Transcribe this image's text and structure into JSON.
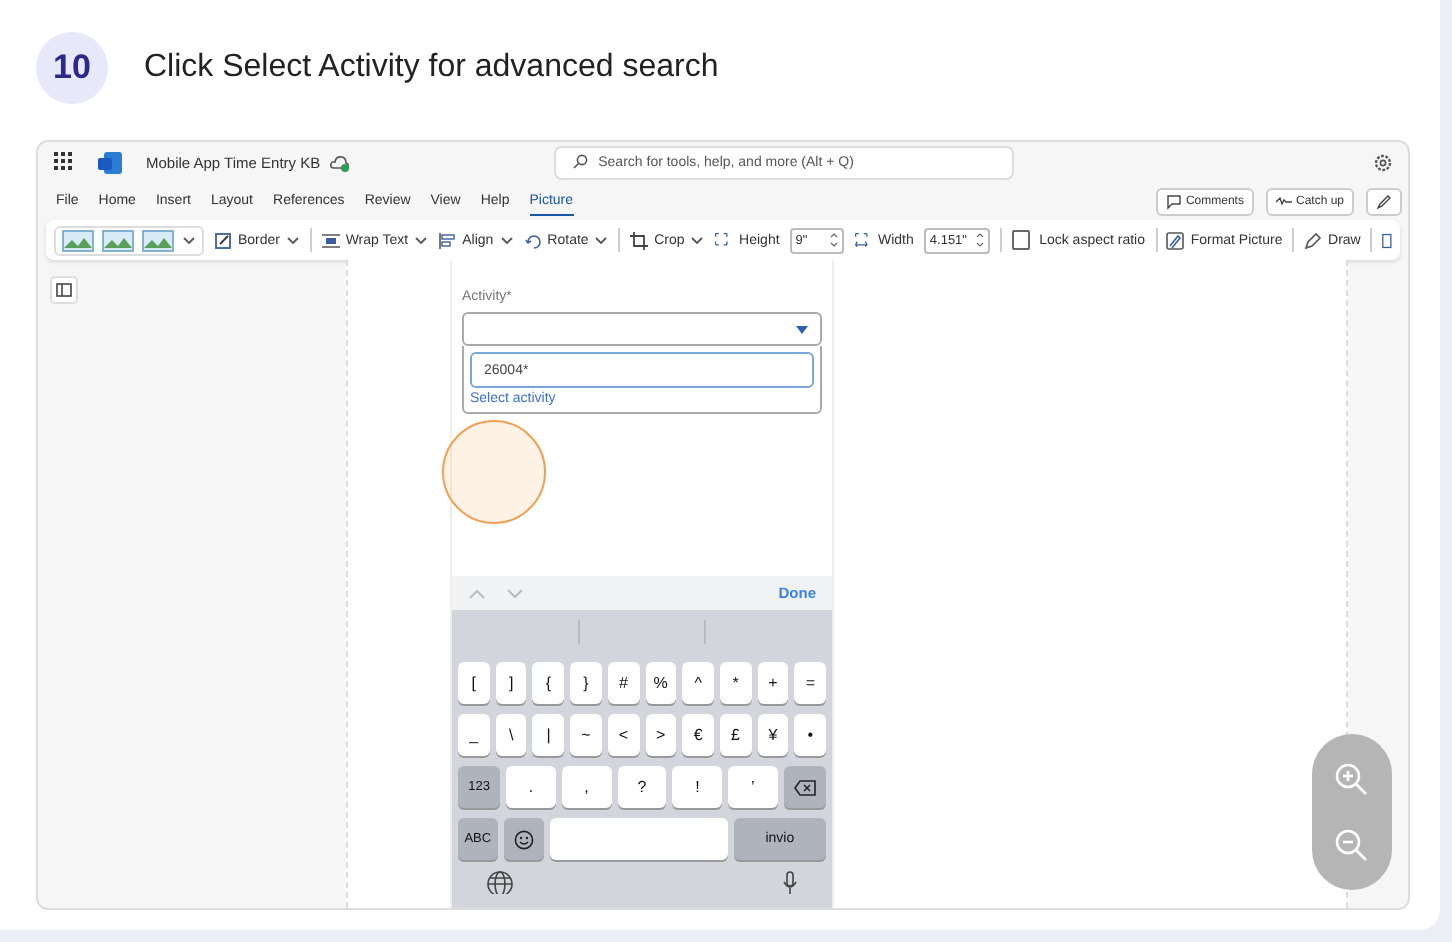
{
  "step": {
    "number": "10",
    "title": "Click Select Activity for advanced search"
  },
  "app": {
    "doc_title": "Mobile App Time Entry KB",
    "search_placeholder": "Search for tools, help, and more (Alt + Q)",
    "menu": [
      {
        "label": "File",
        "selected": false
      },
      {
        "label": "Home",
        "selected": false
      },
      {
        "label": "Insert",
        "selected": false
      },
      {
        "label": "Layout",
        "selected": false
      },
      {
        "label": "References",
        "selected": false
      },
      {
        "label": "Review",
        "selected": false
      },
      {
        "label": "View",
        "selected": false
      },
      {
        "label": "Help",
        "selected": false
      },
      {
        "label": "Picture",
        "selected": true
      }
    ],
    "right_buttons": [
      "Comments",
      "Catch up"
    ],
    "toolbar": [
      {
        "kind": "styles"
      },
      {
        "kind": "menu",
        "label": "Border"
      },
      {
        "kind": "menu",
        "label": "Wrap Text"
      },
      {
        "kind": "menu",
        "label": "Align"
      },
      {
        "kind": "menu",
        "label": "Rotate"
      },
      {
        "kind": "menu",
        "label": "Crop"
      },
      {
        "kind": "spin",
        "label": "Height",
        "value": "9\""
      },
      {
        "kind": "spin",
        "label": "Width",
        "value": "4.151\""
      },
      {
        "kind": "checkbox",
        "label": "Lock aspect ratio",
        "checked": false
      },
      {
        "kind": "button",
        "label": "Format Picture"
      },
      {
        "kind": "button",
        "label": "Draw"
      }
    ]
  },
  "phone": {
    "field_label": "Activity*",
    "search_value": "26004*",
    "link": "Select activity",
    "done": "Done",
    "key_rows": [
      [
        {
          "kind": "char",
          "label": "["
        },
        {
          "kind": "char",
          "label": "]"
        },
        {
          "kind": "char",
          "label": "{"
        },
        {
          "kind": "char",
          "label": "}"
        },
        {
          "kind": "char",
          "label": "#"
        },
        {
          "kind": "char",
          "label": "%"
        },
        {
          "kind": "char",
          "label": "^"
        },
        {
          "kind": "char",
          "label": "*"
        },
        {
          "kind": "char",
          "label": "+"
        },
        {
          "kind": "char",
          "label": "="
        }
      ],
      [
        {
          "kind": "char",
          "label": "_"
        },
        {
          "kind": "char",
          "label": "\\"
        },
        {
          "kind": "char",
          "label": "|"
        },
        {
          "kind": "char",
          "label": "~"
        },
        {
          "kind": "char",
          "label": "<"
        },
        {
          "kind": "char",
          "label": ">"
        },
        {
          "kind": "char",
          "label": "€"
        },
        {
          "kind": "char",
          "label": "£"
        },
        {
          "kind": "char",
          "label": "¥"
        },
        {
          "kind": "char",
          "label": "•"
        }
      ],
      [
        {
          "kind": "fn",
          "label": "123"
        },
        {
          "kind": "wide",
          "label": "."
        },
        {
          "kind": "wide",
          "label": ","
        },
        {
          "kind": "wide",
          "label": "?"
        },
        {
          "kind": "wide",
          "label": "!"
        },
        {
          "kind": "wide",
          "label": "’"
        },
        {
          "kind": "backspace"
        }
      ],
      [
        {
          "kind": "fn",
          "label": "ABC"
        },
        {
          "kind": "emoji"
        },
        {
          "kind": "space"
        },
        {
          "kind": "return",
          "label": "invio"
        }
      ]
    ]
  }
}
